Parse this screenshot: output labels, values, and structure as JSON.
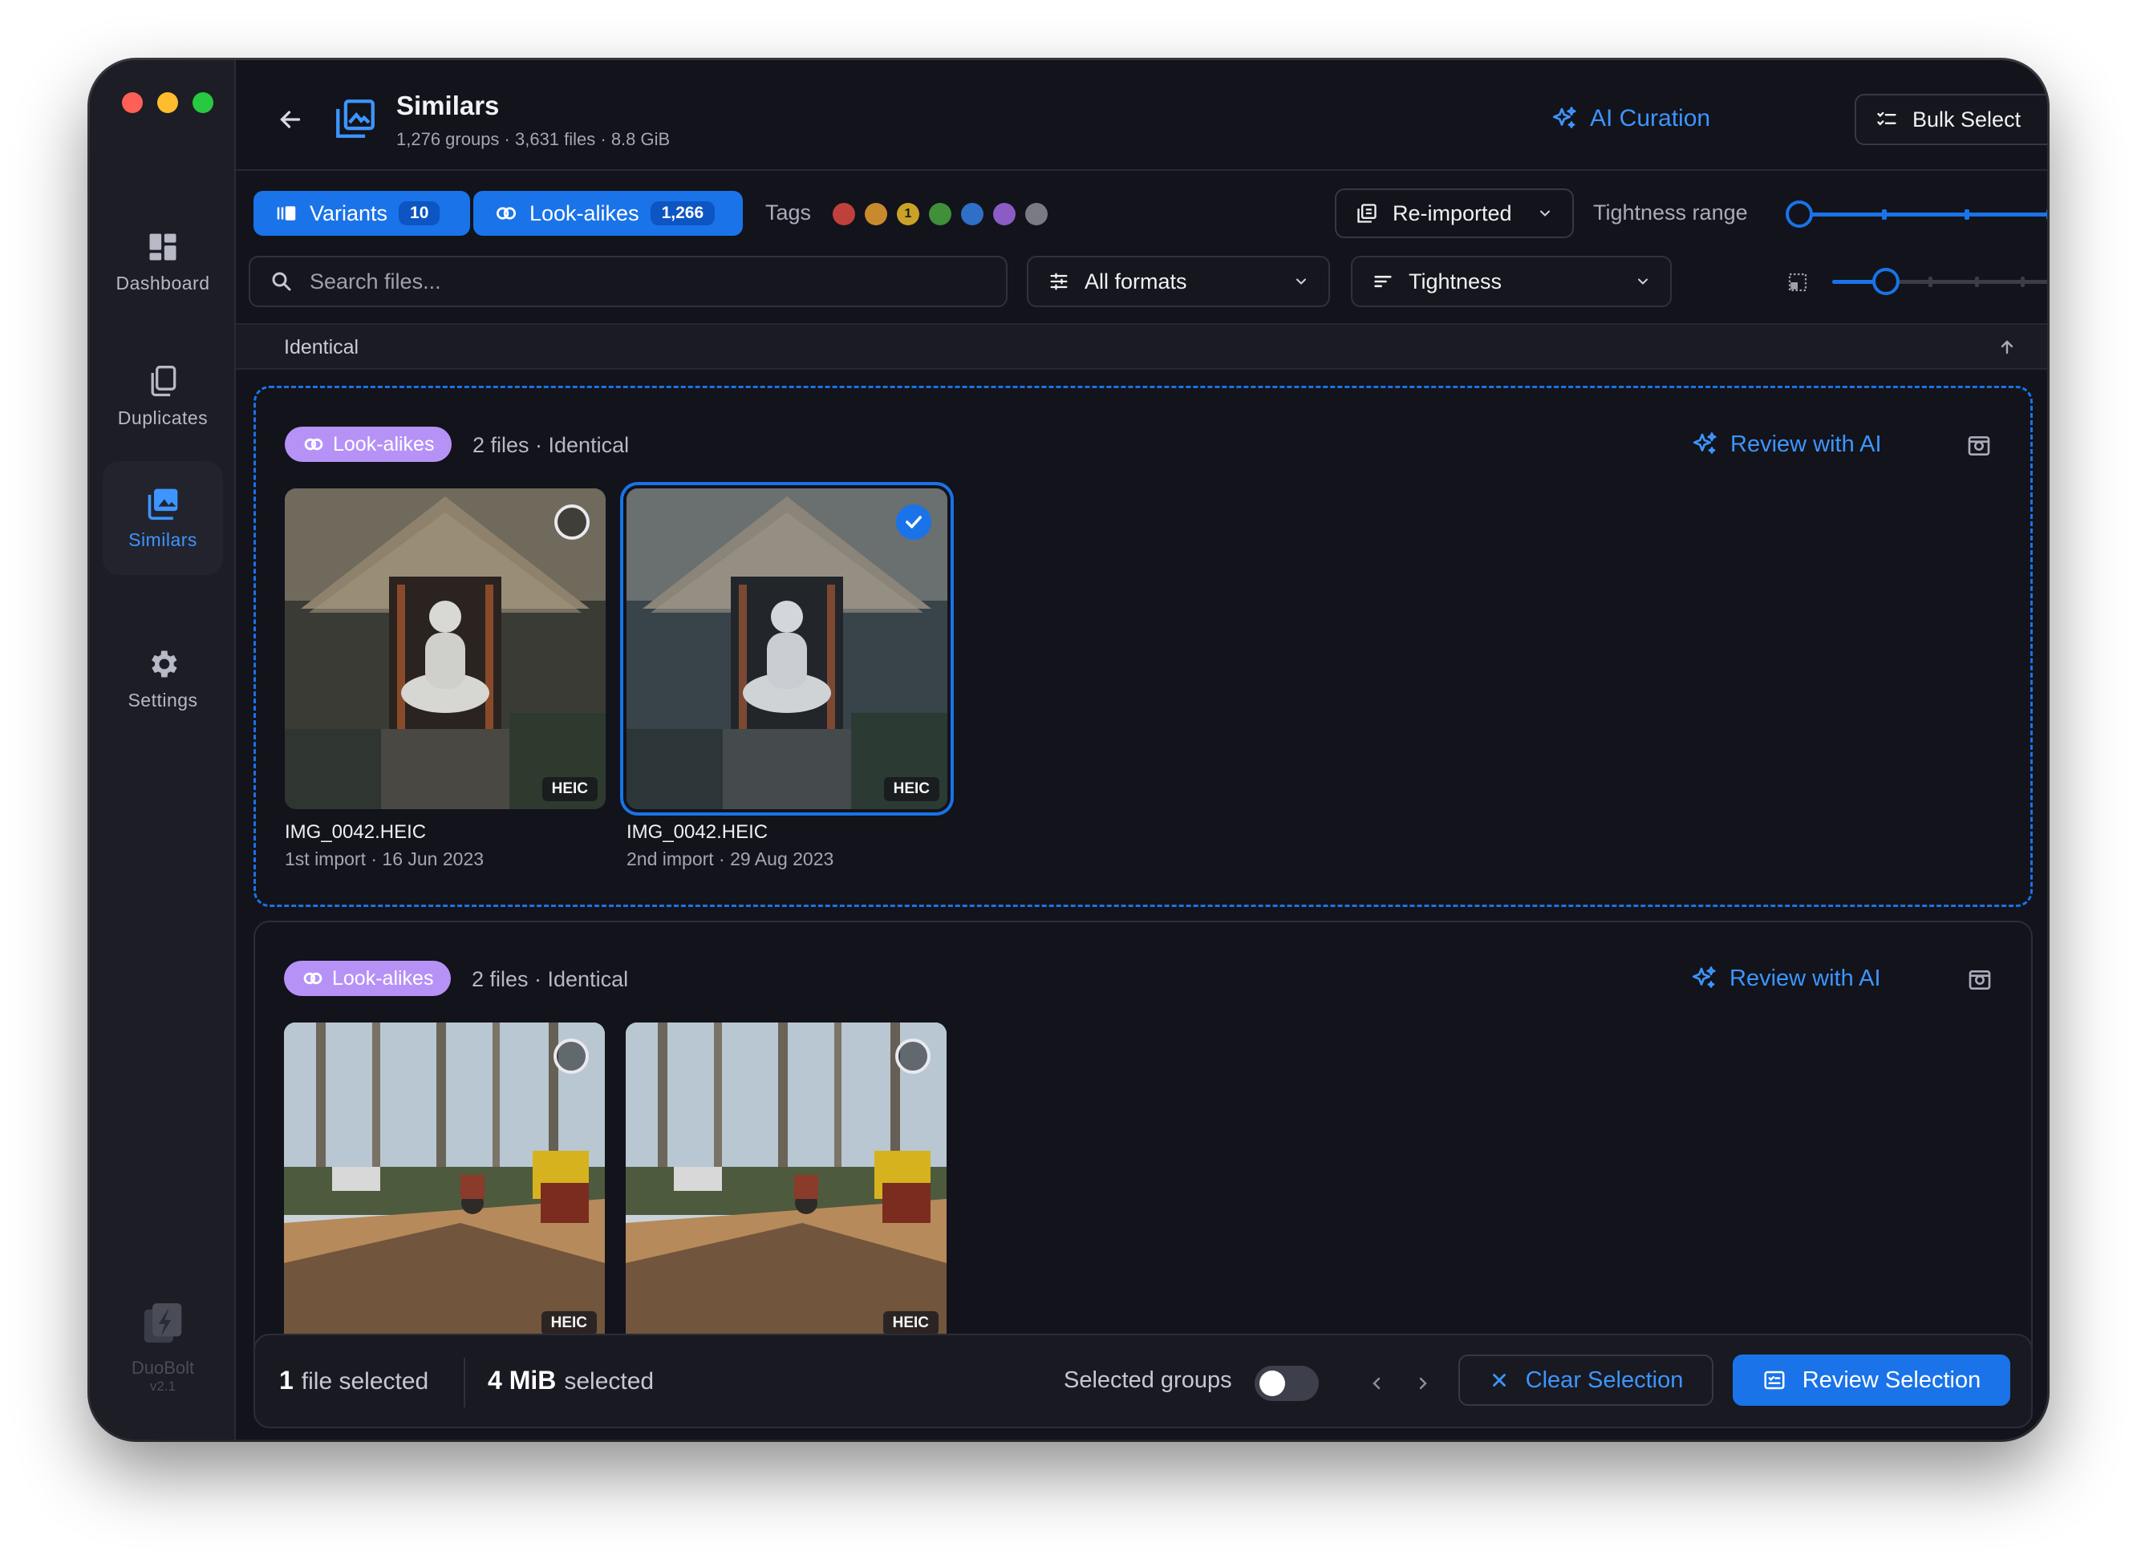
{
  "sidebar": {
    "items": [
      {
        "label": "Dashboard",
        "icon": "dashboard-icon"
      },
      {
        "label": "Duplicates",
        "icon": "duplicates-icon"
      },
      {
        "label": "Similars",
        "icon": "similars-icon",
        "active": true
      },
      {
        "label": "Settings",
        "icon": "gear-icon"
      }
    ],
    "brand": {
      "name": "DuoBolt",
      "version": "v2.1"
    }
  },
  "header": {
    "title": "Similars",
    "subtitle": "1,276 groups · 3,631 files · 8.8 GiB",
    "ai_curation": "AI Curation",
    "bulk_select": "Bulk Select"
  },
  "filters": {
    "variants": {
      "label": "Variants",
      "count": "10"
    },
    "lookalikes": {
      "label": "Look-alikes",
      "count": "1,266"
    },
    "tags_label": "Tags",
    "tags": [
      {
        "color": "#c0413c"
      },
      {
        "color": "#c98a2d"
      },
      {
        "color": "#c9a227",
        "label": "1"
      },
      {
        "color": "#3f8f3b"
      },
      {
        "color": "#2f6fc8"
      },
      {
        "color": "#8a5cc4"
      },
      {
        "color": "#7a7b82"
      }
    ],
    "reimported": "Re-imported",
    "tightness_range_label": "Tightness range",
    "search_placeholder": "Search files...",
    "formats": "All formats",
    "tightness": "Tightness"
  },
  "section": {
    "label": "Identical"
  },
  "groups": [
    {
      "pill": "Look-alikes",
      "meta": "2 files · Identical",
      "review": "Review with AI",
      "files": [
        {
          "name": "IMG_0042.HEIC",
          "meta": "1st import · 16 Jun 2023",
          "format": "HEIC",
          "selected": false
        },
        {
          "name": "IMG_0042.HEIC",
          "meta": "2nd import · 29 Aug 2023",
          "format": "HEIC",
          "selected": true
        }
      ]
    },
    {
      "pill": "Look-alikes",
      "meta": "2 files · Identical",
      "review": "Review with AI",
      "files": [
        {
          "format": "HEIC",
          "selected": false
        },
        {
          "format": "HEIC",
          "selected": false
        }
      ]
    }
  ],
  "bottom": {
    "file_count": "1",
    "file_label": "file selected",
    "size_value": "4 MiB",
    "size_label": "selected",
    "selected_groups": "Selected groups",
    "clear": "Clear Selection",
    "review": "Review Selection"
  },
  "colors": {
    "accent": "#1a73e8",
    "accent_text": "#3d95ff",
    "pill": "#b692f6",
    "background": "#12131b"
  }
}
